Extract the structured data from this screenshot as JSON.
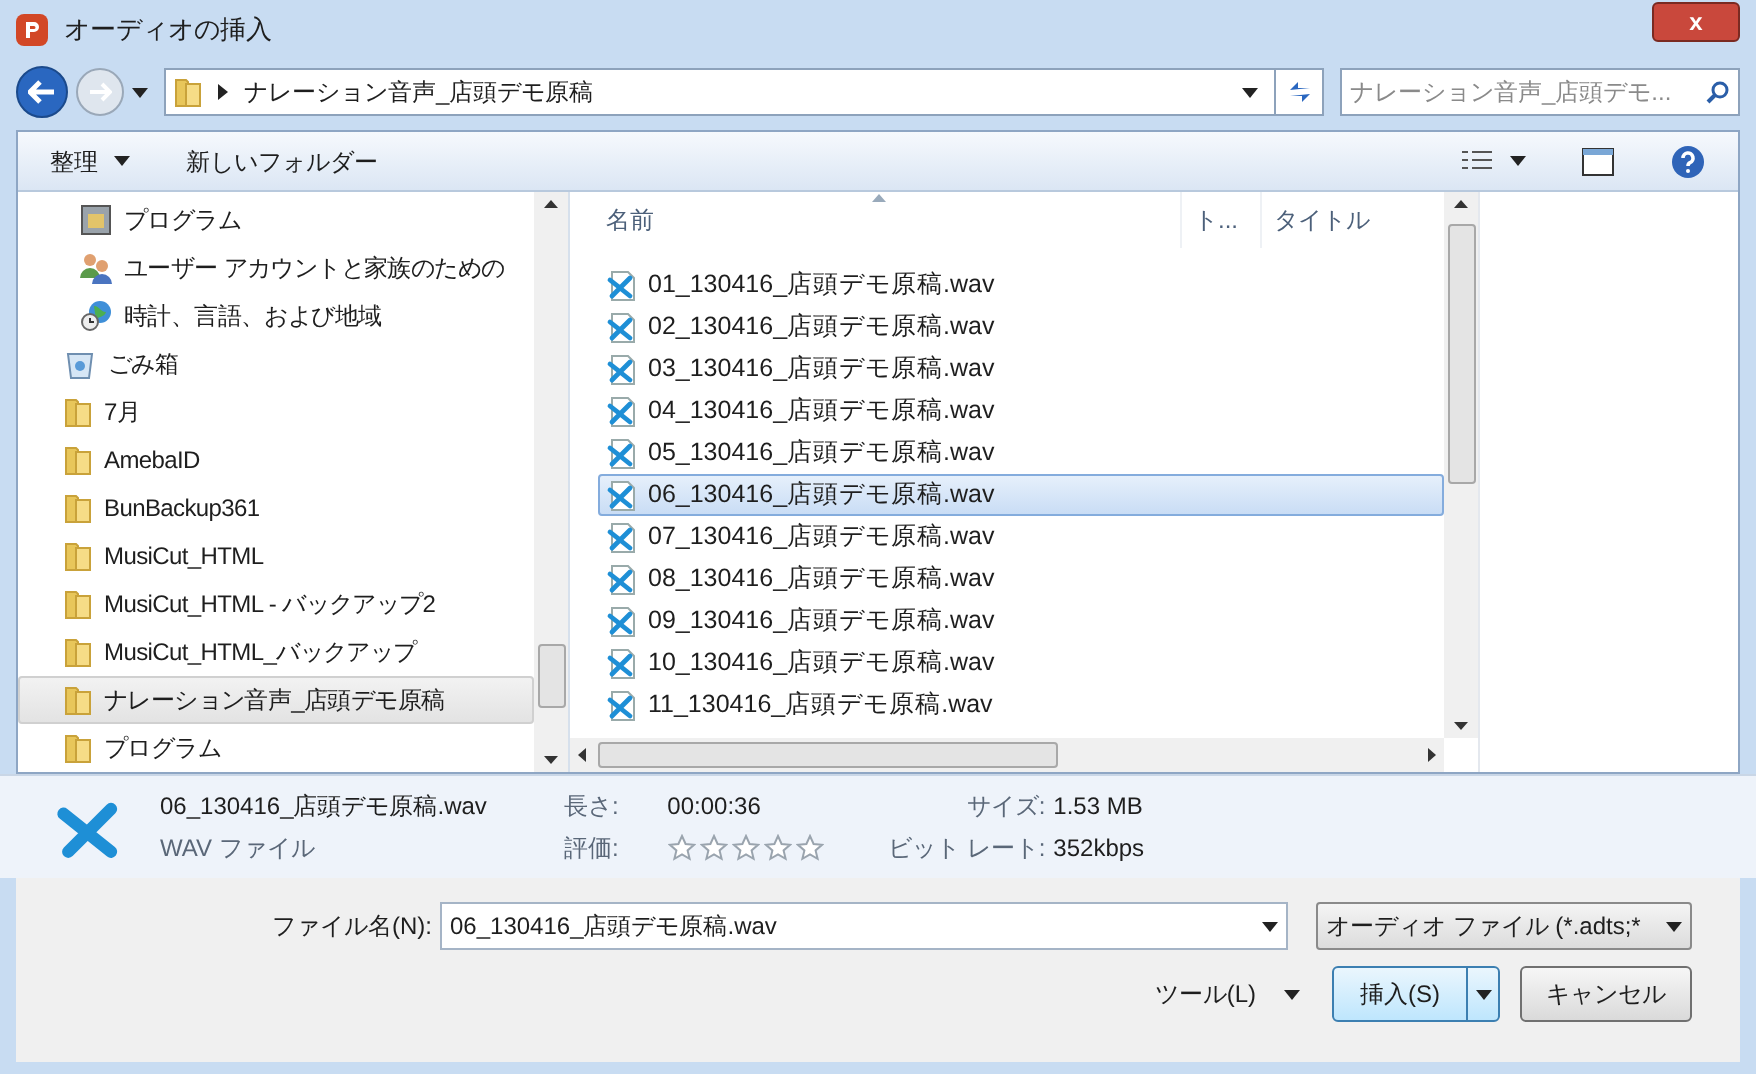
{
  "window": {
    "title": "オーディオの挿入",
    "close": "x"
  },
  "address": {
    "path": "ナレーション音声_店頭デモ原稿"
  },
  "search": {
    "placeholder": "ナレーション音声_店頭デモ..."
  },
  "toolbar": {
    "organize": "整理",
    "new_folder": "新しいフォルダー"
  },
  "sidebar": {
    "items": [
      {
        "label": "プログラム",
        "kind": "control",
        "selected": false
      },
      {
        "label": "ユーザー アカウントと家族のための",
        "kind": "users",
        "selected": false
      },
      {
        "label": "時計、言語、および地域",
        "kind": "globe",
        "selected": false
      },
      {
        "label": "ごみ箱",
        "kind": "trash",
        "selected": false
      },
      {
        "label": "7月",
        "kind": "folder",
        "selected": false
      },
      {
        "label": "AmebaID",
        "kind": "folder",
        "selected": false
      },
      {
        "label": "BunBackup361",
        "kind": "folder",
        "selected": false
      },
      {
        "label": "MusiCut_HTML",
        "kind": "folder",
        "selected": false
      },
      {
        "label": "MusiCut_HTML - バックアップ2",
        "kind": "folder",
        "selected": false
      },
      {
        "label": "MusiCut_HTML_バックアップ",
        "kind": "folder",
        "selected": false
      },
      {
        "label": "ナレーション音声_店頭デモ原稿",
        "kind": "folder",
        "selected": true
      },
      {
        "label": "プログラム",
        "kind": "folder",
        "selected": false
      }
    ]
  },
  "table": {
    "columns": [
      "名前",
      "ト...",
      "タイトル"
    ],
    "rows": [
      {
        "name": "01_130416_店頭デモ原稿.wav",
        "selected": false
      },
      {
        "name": "02_130416_店頭デモ原稿.wav",
        "selected": false
      },
      {
        "name": "03_130416_店頭デモ原稿.wav",
        "selected": false
      },
      {
        "name": "04_130416_店頭デモ原稿.wav",
        "selected": false
      },
      {
        "name": "05_130416_店頭デモ原稿.wav",
        "selected": false
      },
      {
        "name": "06_130416_店頭デモ原稿.wav",
        "selected": true
      },
      {
        "name": "07_130416_店頭デモ原稿.wav",
        "selected": false
      },
      {
        "name": "08_130416_店頭デモ原稿.wav",
        "selected": false
      },
      {
        "name": "09_130416_店頭デモ原稿.wav",
        "selected": false
      },
      {
        "name": "10_130416_店頭デモ原稿.wav",
        "selected": false
      },
      {
        "name": "11_130416_店頭デモ原稿.wav",
        "selected": false
      }
    ]
  },
  "details": {
    "name": "06_130416_店頭デモ原稿.wav",
    "type": "WAV ファイル",
    "length_label": "長さ:",
    "length": "00:00:36",
    "rating_label": "評価:",
    "stars": 0,
    "size_label": "サイズ:",
    "size": "1.53 MB",
    "bitrate_label": "ビット レート:",
    "bitrate": "352kbps"
  },
  "footer": {
    "filename_label": "ファイル名(N):",
    "filename": "06_130416_店頭デモ原稿.wav",
    "filter": "オーディオ ファイル (*.adts;*",
    "tools": "ツール(L)",
    "insert": "挿入(S)",
    "cancel": "キャンセル"
  }
}
